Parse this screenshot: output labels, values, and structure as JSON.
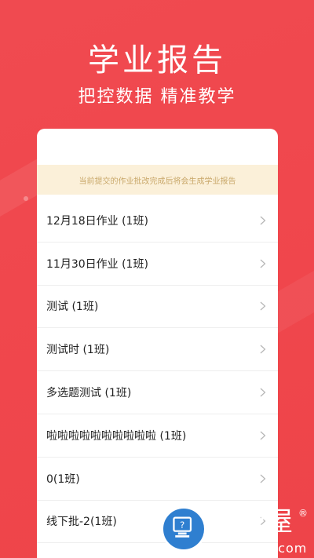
{
  "hero": {
    "title": "学业报告",
    "subtitle": "把控数据  精准教学"
  },
  "notice": {
    "text": "当前提交的作业批改完成后将会生成学业报告"
  },
  "list": {
    "items": [
      {
        "label": "12月18日作业 (1班)"
      },
      {
        "label": "11月30日作业 (1班)"
      },
      {
        "label": "测试 (1班)"
      },
      {
        "label": "测试时 (1班)"
      },
      {
        "label": "多选题测试 (1班)"
      },
      {
        "label": "啦啦啦啦啦啦啦啦啦啦 (1班)"
      },
      {
        "label": "0(1班)"
      },
      {
        "label": "线下批-2(1班)"
      }
    ]
  },
  "watermark": {
    "brand": "知识屋",
    "url": "zhishiwu.com",
    "reg": "®"
  },
  "colors": {
    "background": "#f04a50",
    "notice_bg": "#fbf0d9",
    "notice_text": "#c9a86a"
  }
}
